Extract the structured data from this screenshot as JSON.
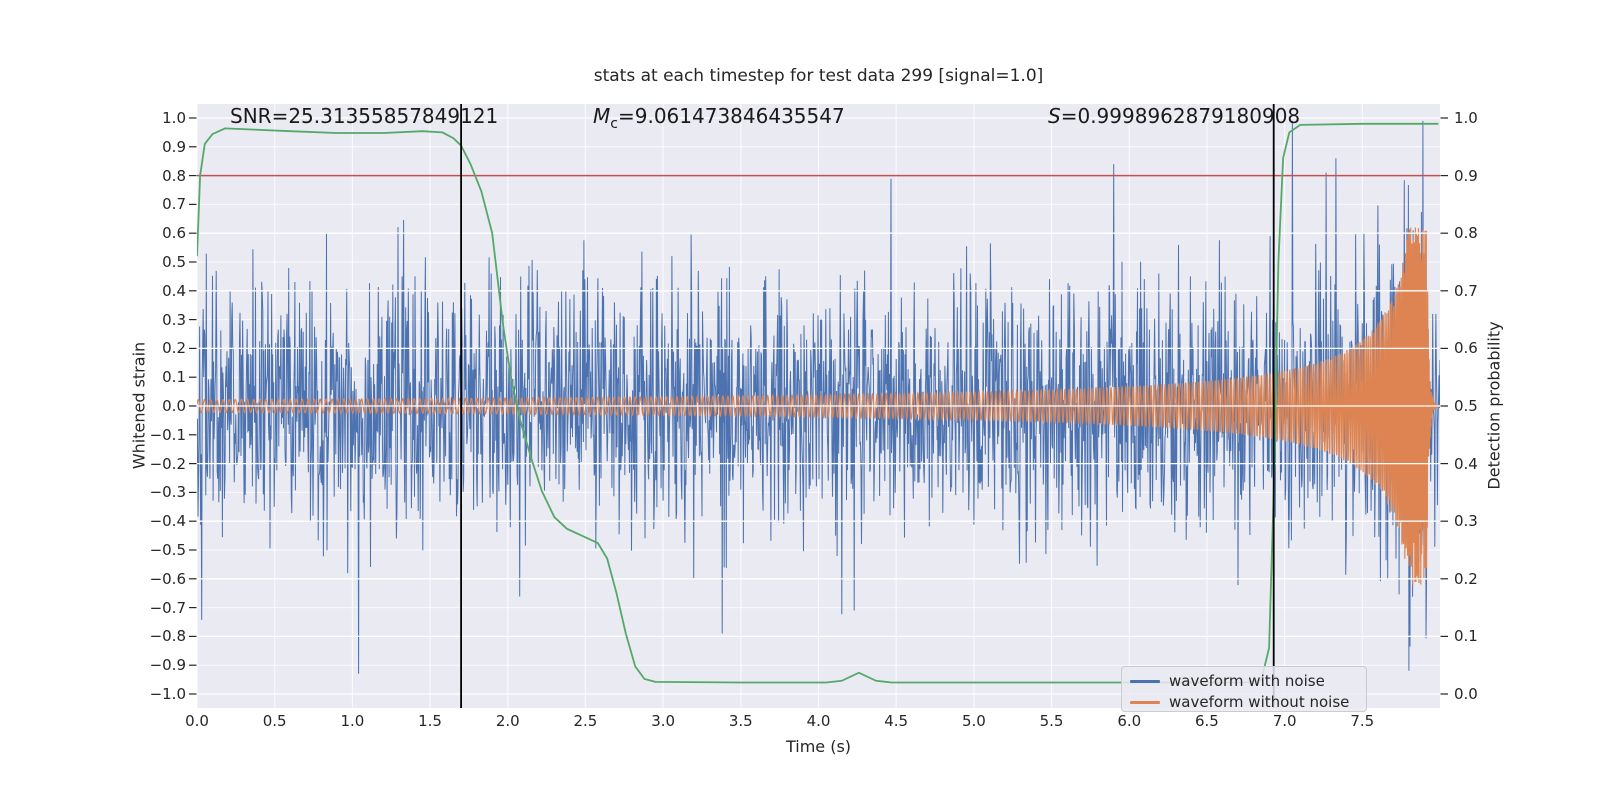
{
  "chart_data": {
    "type": "line",
    "title": "stats at each timestep for test data 299 [signal=1.0]",
    "xlabel": "Time (s)",
    "ylabel_left": "Whitened strain",
    "ylabel_right": "Detection probability",
    "xlim": [
      0,
      8
    ],
    "ylim_left": [
      -1.05,
      1.05
    ],
    "ylim_right": [
      -0.024,
      1.024
    ],
    "background_color": "#eaeaf2",
    "grid": {
      "color": "#ffffff",
      "horizontal_under_step_strain": 0.1,
      "vertical_step_s": 0.5,
      "overlay_step_prob": 0.1
    },
    "x_ticks": [
      {
        "v": 0.0,
        "label": "0.0"
      },
      {
        "v": 0.5,
        "label": "0.5"
      },
      {
        "v": 1.0,
        "label": "1.0"
      },
      {
        "v": 1.5,
        "label": "1.5"
      },
      {
        "v": 2.0,
        "label": "2.0"
      },
      {
        "v": 2.5,
        "label": "2.5"
      },
      {
        "v": 3.0,
        "label": "3.0"
      },
      {
        "v": 3.5,
        "label": "3.5"
      },
      {
        "v": 4.0,
        "label": "4.0"
      },
      {
        "v": 4.5,
        "label": "4.5"
      },
      {
        "v": 5.0,
        "label": "5.0"
      },
      {
        "v": 5.5,
        "label": "5.5"
      },
      {
        "v": 6.0,
        "label": "6.0"
      },
      {
        "v": 6.5,
        "label": "6.5"
      },
      {
        "v": 7.0,
        "label": "7.0"
      },
      {
        "v": 7.5,
        "label": "7.5"
      }
    ],
    "left_ticks": [
      {
        "v": 1.0,
        "label": "1.0"
      },
      {
        "v": 0.9,
        "label": "0.9"
      },
      {
        "v": 0.8,
        "label": "0.8"
      },
      {
        "v": 0.7,
        "label": "0.7"
      },
      {
        "v": 0.6,
        "label": "0.6"
      },
      {
        "v": 0.5,
        "label": "0.5"
      },
      {
        "v": 0.4,
        "label": "0.4"
      },
      {
        "v": 0.3,
        "label": "0.3"
      },
      {
        "v": 0.2,
        "label": "0.2"
      },
      {
        "v": 0.1,
        "label": "0.1"
      },
      {
        "v": 0.0,
        "label": "0.0"
      },
      {
        "v": -0.1,
        "label": "−0.1"
      },
      {
        "v": -0.2,
        "label": "−0.2"
      },
      {
        "v": -0.3,
        "label": "−0.3"
      },
      {
        "v": -0.4,
        "label": "−0.4"
      },
      {
        "v": -0.5,
        "label": "−0.5"
      },
      {
        "v": -0.6,
        "label": "−0.6"
      },
      {
        "v": -0.7,
        "label": "−0.7"
      },
      {
        "v": -0.8,
        "label": "−0.8"
      },
      {
        "v": -0.9,
        "label": "−0.9"
      },
      {
        "v": -1.0,
        "label": "−1.0"
      }
    ],
    "right_ticks": [
      {
        "v": 1.0,
        "label": "1.0"
      },
      {
        "v": 0.9,
        "label": "0.9"
      },
      {
        "v": 0.8,
        "label": "0.8"
      },
      {
        "v": 0.7,
        "label": "0.7"
      },
      {
        "v": 0.6,
        "label": "0.6"
      },
      {
        "v": 0.5,
        "label": "0.5"
      },
      {
        "v": 0.4,
        "label": "0.4"
      },
      {
        "v": 0.3,
        "label": "0.3"
      },
      {
        "v": 0.2,
        "label": "0.2"
      },
      {
        "v": 0.1,
        "label": "0.1"
      },
      {
        "v": 0.0,
        "label": "0.0"
      }
    ],
    "annotations": [
      {
        "label": "SNR",
        "sub": "",
        "eq": "=",
        "value": "25.31355857849121",
        "style_class": "ann-label"
      },
      {
        "label": "M",
        "sub": "c",
        "eq": "=",
        "value": "9.061473846435547",
        "style_class": "ann-label italic"
      },
      {
        "label": "S",
        "sub": "",
        "eq": "=",
        "value": "0.9998962879180908",
        "style_class": "ann-label italic"
      }
    ],
    "threshold_line": {
      "axis": "right",
      "value": 0.9,
      "color": "#c44e52"
    },
    "event_lines": {
      "times_s": [
        1.7,
        6.93
      ],
      "color": "#000000"
    },
    "series": [
      {
        "name": "waveform with noise",
        "color": "#4c72b0",
        "axis": "left",
        "kind": "noise_plus_signal",
        "noise_sigma": 0.22,
        "samples": 2400,
        "seed": 42,
        "notable_spikes": [
          [
            1.04,
            -0.93
          ],
          [
            3.38,
            -0.79
          ],
          [
            4.23,
            -0.71
          ],
          [
            5.9,
            0.84
          ],
          [
            7.05,
            0.99
          ],
          [
            7.33,
            0.86
          ],
          [
            7.89,
            0.99
          ]
        ]
      },
      {
        "name": "waveform without noise",
        "color": "#dd8452",
        "axis": "left",
        "kind": "chirp",
        "f0_hz": 25,
        "freq_exp": 0.375,
        "t_merge_s": 7.92,
        "amp0": 0.022,
        "amp_exp": 0.8,
        "amp_cap": 0.62,
        "ringdown_tau_s": 0.013,
        "samples": 4800
      },
      {
        "name": "detection probability",
        "color": "#55a868",
        "axis": "right",
        "kind": "keypoints",
        "keypoints": [
          [
            0.0,
            0.76
          ],
          [
            0.02,
            0.9
          ],
          [
            0.05,
            0.955
          ],
          [
            0.1,
            0.972
          ],
          [
            0.18,
            0.982
          ],
          [
            0.35,
            0.98
          ],
          [
            0.6,
            0.977
          ],
          [
            0.9,
            0.974
          ],
          [
            1.2,
            0.974
          ],
          [
            1.45,
            0.977
          ],
          [
            1.58,
            0.975
          ],
          [
            1.65,
            0.965
          ],
          [
            1.7,
            0.952
          ],
          [
            1.76,
            0.92
          ],
          [
            1.83,
            0.873
          ],
          [
            1.9,
            0.8
          ],
          [
            1.97,
            0.64
          ],
          [
            2.02,
            0.55
          ],
          [
            2.08,
            0.475
          ],
          [
            2.15,
            0.41
          ],
          [
            2.22,
            0.352
          ],
          [
            2.3,
            0.307
          ],
          [
            2.38,
            0.287
          ],
          [
            2.5,
            0.272
          ],
          [
            2.58,
            0.262
          ],
          [
            2.64,
            0.235
          ],
          [
            2.7,
            0.175
          ],
          [
            2.76,
            0.105
          ],
          [
            2.82,
            0.048
          ],
          [
            2.88,
            0.026
          ],
          [
            2.95,
            0.021
          ],
          [
            3.5,
            0.02
          ],
          [
            4.05,
            0.02
          ],
          [
            4.15,
            0.023
          ],
          [
            4.26,
            0.037
          ],
          [
            4.37,
            0.023
          ],
          [
            4.47,
            0.02
          ],
          [
            5.5,
            0.02
          ],
          [
            6.75,
            0.02
          ],
          [
            6.85,
            0.024
          ],
          [
            6.9,
            0.08
          ],
          [
            6.93,
            0.35
          ],
          [
            6.96,
            0.75
          ],
          [
            6.99,
            0.93
          ],
          [
            7.03,
            0.975
          ],
          [
            7.1,
            0.988
          ],
          [
            7.5,
            0.99
          ],
          [
            7.99,
            0.99
          ]
        ]
      }
    ],
    "legend": {
      "entries": [
        {
          "label": "waveform with noise",
          "color": "#4c72b0"
        },
        {
          "label": "waveform without noise",
          "color": "#dd8452"
        }
      ]
    }
  },
  "colors": {
    "blue": "#4c72b0",
    "orange": "#dd8452",
    "green": "#55a868",
    "red": "#c44e52",
    "plot_bg": "#eaeaf2",
    "grid": "#ffffff",
    "text": "#262626"
  }
}
